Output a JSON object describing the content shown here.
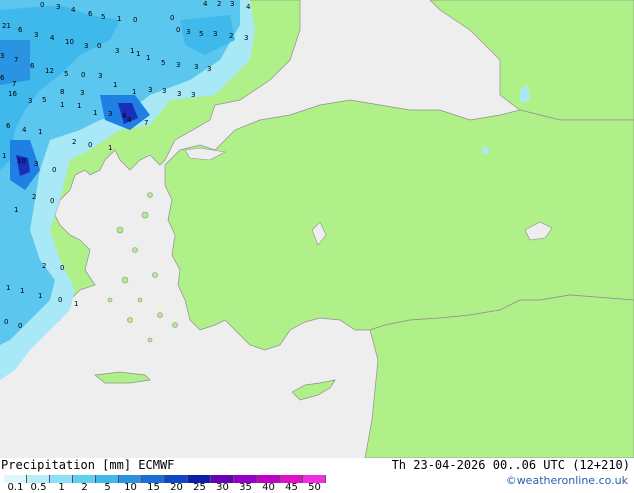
{
  "map": {
    "legend_title": "Precipitation [mm]",
    "model": "ECMWF",
    "valid_time": "Th 23-04-2026 00..06 UTC (12+210)",
    "credit": "©weatheronline.co.uk",
    "colors": {
      "sea": "#eeeeee",
      "land": "#b0f089",
      "coast": "#8f8f8f",
      "precip_light": "#a9e8f7",
      "precip_mid": "#5cc7ee",
      "precip_heavy": "#1f7fe3",
      "precip_max": "#1a2fb8"
    },
    "scale_ticks": [
      "0.1",
      "0.5",
      "1",
      "2",
      "5",
      "10",
      "15",
      "20",
      "25",
      "30",
      "35",
      "40",
      "45",
      "50"
    ],
    "scale_colors": [
      "#dff7fb",
      "#b7eef9",
      "#8ce1f6",
      "#5fcff1",
      "#3fb8ec",
      "#2a94e2",
      "#1c6fd6",
      "#1147c4",
      "#0b1fa8",
      "#6a00b4",
      "#9400c8",
      "#c000c8",
      "#e010c8",
      "#f030e0"
    ],
    "precip_values": [
      "0",
      "3",
      "4",
      "6",
      "5",
      "1",
      "0",
      "4",
      "2",
      "3",
      "4",
      "0",
      "21",
      "6",
      "3",
      "4",
      "10",
      "3",
      "0",
      "3",
      "1",
      "0",
      "3",
      "5",
      "3",
      "2",
      "3",
      "1",
      "3",
      "7",
      "6",
      "12",
      "5",
      "0",
      "3",
      "1",
      "5",
      "3",
      "3",
      "3",
      "1",
      "6",
      "7",
      "16",
      "5",
      "8",
      "3",
      "1",
      "3",
      "3",
      "3",
      "3",
      "3",
      "1",
      "1",
      "1",
      "3",
      "4",
      "4",
      "7",
      "6",
      "4",
      "1",
      "2",
      "0",
      "1",
      "1",
      "10",
      "3",
      "0",
      "2",
      "0",
      "1",
      "2",
      "0",
      "1",
      "1",
      "1",
      "0",
      "1",
      "0",
      "0"
    ]
  }
}
